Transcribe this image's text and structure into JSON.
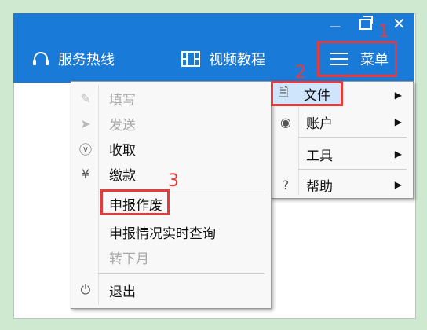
{
  "titlebar": {
    "controls": {
      "minimize": "—",
      "close": "✕"
    },
    "nav": {
      "hotline_label": "服务热线",
      "video_label": "视频教程",
      "menu_label": "菜单"
    }
  },
  "step_numbers": {
    "one": "1",
    "two": "2",
    "three": "3"
  },
  "main_menu": {
    "items": [
      {
        "label": "文件",
        "icon": "file-icon",
        "arrow": "▶"
      },
      {
        "label": "账户",
        "icon": "user-icon",
        "arrow": "▶"
      },
      {
        "label": "工具",
        "icon": "",
        "arrow": "▶"
      },
      {
        "label": "帮助",
        "icon": "help-icon",
        "arrow": "▶"
      }
    ]
  },
  "file_submenu": {
    "items": [
      {
        "label": "填写",
        "icon": "edit-icon",
        "disabled": true
      },
      {
        "label": "发送",
        "icon": "send-icon",
        "disabled": true
      },
      {
        "label": "收取",
        "icon": "download-icon",
        "disabled": false
      },
      {
        "label": "缴款",
        "icon": "yen-icon",
        "disabled": false
      },
      {
        "label": "申报作废",
        "icon": "",
        "disabled": false
      },
      {
        "label": "申报情况实时查询",
        "icon": "",
        "disabled": false
      },
      {
        "label": "转下月",
        "icon": "",
        "disabled": true
      },
      {
        "label": "退出",
        "icon": "power-icon",
        "disabled": false
      }
    ]
  },
  "colors": {
    "titlebar": "#1a7ad8",
    "highlight": "#e83a3a",
    "selected": "#cfe5fb",
    "background": "#cfe9d0"
  }
}
